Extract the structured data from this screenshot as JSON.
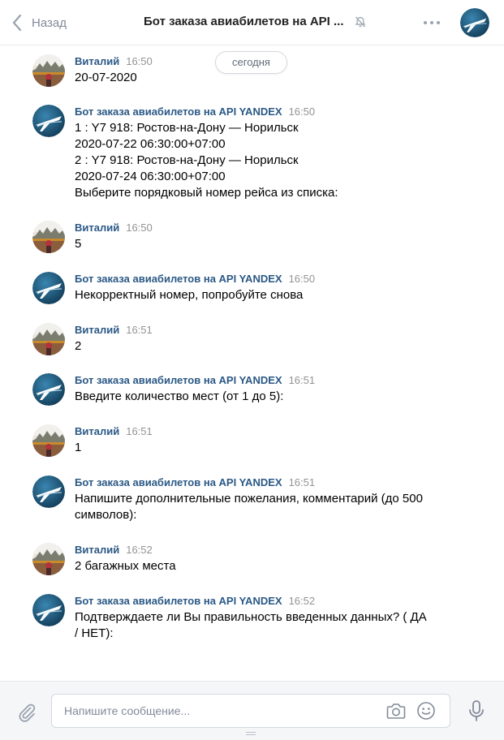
{
  "header": {
    "back_label": "Назад",
    "title": "Бот заказа авиабилетов на API ...",
    "icons": {
      "back": "chevron-left-icon",
      "mute": "muted-bell-icon",
      "more": "more-dots-icon"
    }
  },
  "chat": {
    "date_label": "сегодня",
    "messages": [
      {
        "author": "Виталий",
        "time": "16:50",
        "avatar": "user-photo",
        "lines": [
          "20-07-2020"
        ]
      },
      {
        "author": "Бот заказа авиабилетов на API YANDEX",
        "time": "16:50",
        "avatar": "airplane-logo",
        "lines": [
          "1 : Y7 918: Ростов-на-Дону — Норильск",
          "2020-07-22 06:30:00+07:00",
          "2 : Y7 918: Ростов-на-Дону — Норильск",
          "2020-07-24 06:30:00+07:00",
          "Выберите порядковый номер рейса из списка:"
        ]
      },
      {
        "author": "Виталий",
        "time": "16:50",
        "avatar": "user-photo",
        "lines": [
          "5"
        ]
      },
      {
        "author": "Бот заказа авиабилетов на API YANDEX",
        "time": "16:50",
        "avatar": "airplane-logo",
        "lines": [
          "Некорректный номер, попробуйте снова"
        ]
      },
      {
        "author": "Виталий",
        "time": "16:51",
        "avatar": "user-photo",
        "lines": [
          "2"
        ]
      },
      {
        "author": "Бот заказа авиабилетов на API YANDEX",
        "time": "16:51",
        "avatar": "airplane-logo",
        "lines": [
          "Введите количество мест (от 1 до 5):"
        ]
      },
      {
        "author": "Виталий",
        "time": "16:51",
        "avatar": "user-photo",
        "lines": [
          "1"
        ]
      },
      {
        "author": "Бот заказа авиабилетов на API YANDEX",
        "time": "16:51",
        "avatar": "airplane-logo",
        "lines": [
          "Напишите дополнительные пожелания, комментарий (до 500",
          "символов):"
        ]
      },
      {
        "author": "Виталий",
        "time": "16:52",
        "avatar": "user-photo",
        "lines": [
          "2 багажных места"
        ]
      },
      {
        "author": "Бот заказа авиабилетов на API YANDEX",
        "time": "16:52",
        "avatar": "airplane-logo",
        "lines": [
          "Подтверждаете ли Вы правильность введенных данных? ( ДА",
          "/ НЕТ):"
        ]
      }
    ]
  },
  "composer": {
    "placeholder": "Напишите сообщение...",
    "icons": {
      "attach": "paperclip-icon",
      "camera": "camera-icon",
      "emoji": "smile-icon",
      "voice": "microphone-icon"
    }
  },
  "colors": {
    "author_name": "#2a5885",
    "muted_text": "#828a99",
    "timestamp": "#939393",
    "bot_avatar_bg": "#1f5a7e"
  }
}
